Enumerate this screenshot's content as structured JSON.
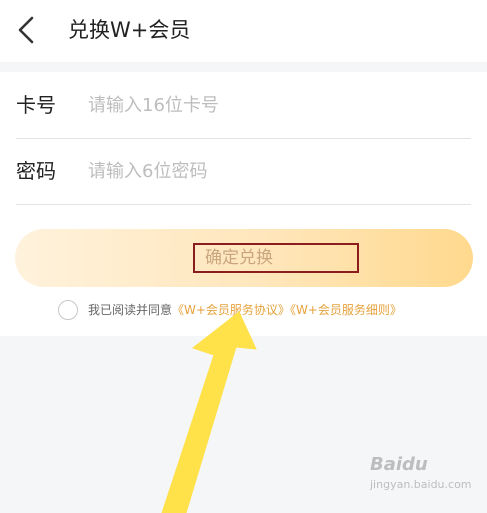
{
  "header": {
    "title": "兑换W+会员",
    "back_icon": "chevron-left-icon"
  },
  "form": {
    "card_number": {
      "label": "卡号",
      "placeholder": "请输入16位卡号"
    },
    "password": {
      "label": "密码",
      "placeholder": "请输入6位密码"
    },
    "confirm_label": "确定兑换"
  },
  "agreement": {
    "prefix": "我已阅读并同意",
    "link1": "《W+会员服务协议》",
    "link2": "《W+会员服务细则》"
  },
  "colors": {
    "accent": "#e6a23c",
    "button_gradient_start": "#fff2dc",
    "button_gradient_end": "#ffd98d",
    "highlight_box": "#8a1d1d",
    "arrow": "#ffe14a"
  },
  "watermark": {
    "brand": "Baidu",
    "sub": "jingyan.baidu.com"
  }
}
